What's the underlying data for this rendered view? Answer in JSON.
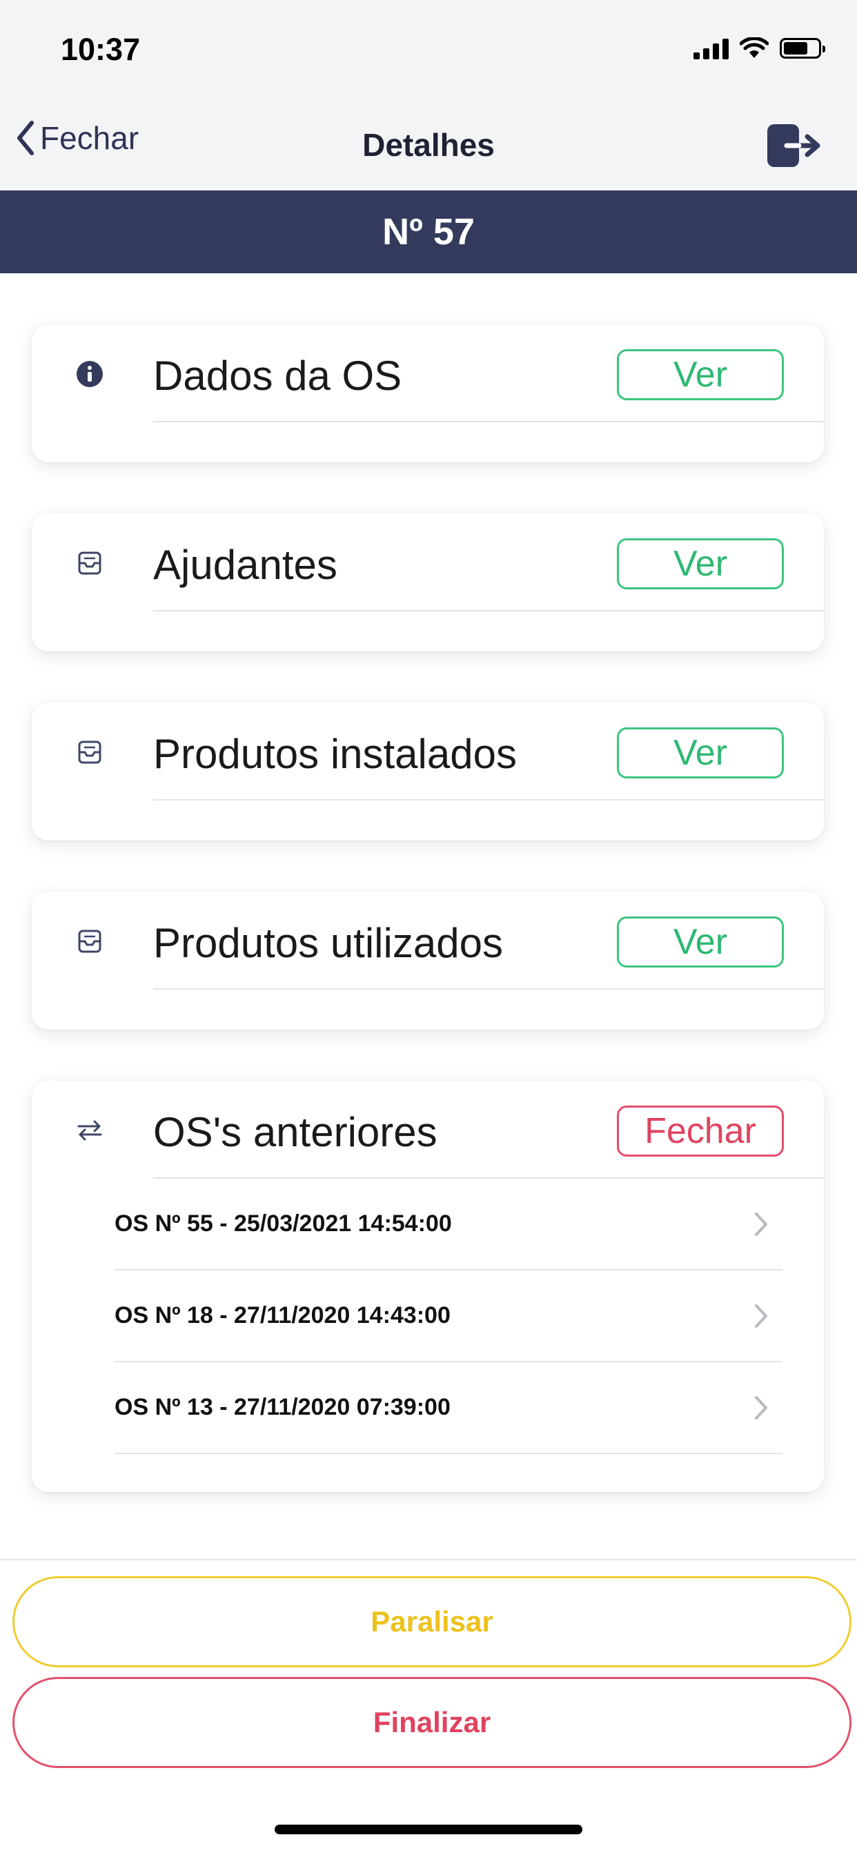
{
  "status_bar": {
    "time": "10:37"
  },
  "nav": {
    "back_label": "Fechar",
    "title": "Detalhes"
  },
  "order_number": "Nº 57",
  "sections": [
    {
      "title": "Dados da OS",
      "icon": "info-icon",
      "action_label": "Ver",
      "action_color": "#2eb872"
    },
    {
      "title": "Ajudantes",
      "icon": "tray-icon",
      "action_label": "Ver",
      "action_color": "#2eb872"
    },
    {
      "title": "Produtos instalados",
      "icon": "tray-icon",
      "action_label": "Ver",
      "action_color": "#2eb872"
    },
    {
      "title": "Produtos utilizados",
      "icon": "tray-icon",
      "action_label": "Ver",
      "action_color": "#2eb872"
    },
    {
      "title": "OS's anteriores",
      "icon": "swap-arrows-icon",
      "action_label": "Fechar",
      "action_color": "#e0435f"
    }
  ],
  "previous_orders": [
    {
      "label": "OS Nº 55 - 25/03/2021 14:54:00"
    },
    {
      "label": "OS Nº 18 - 27/11/2020 14:43:00"
    },
    {
      "label": "OS Nº 13 - 27/11/2020 07:39:00"
    }
  ],
  "buttons": {
    "pause": "Paralisar",
    "finish": "Finalizar"
  },
  "colors": {
    "navy": "#333a5c",
    "green": "#2eb872",
    "red": "#e0435f",
    "yellow": "#ecc21c"
  }
}
